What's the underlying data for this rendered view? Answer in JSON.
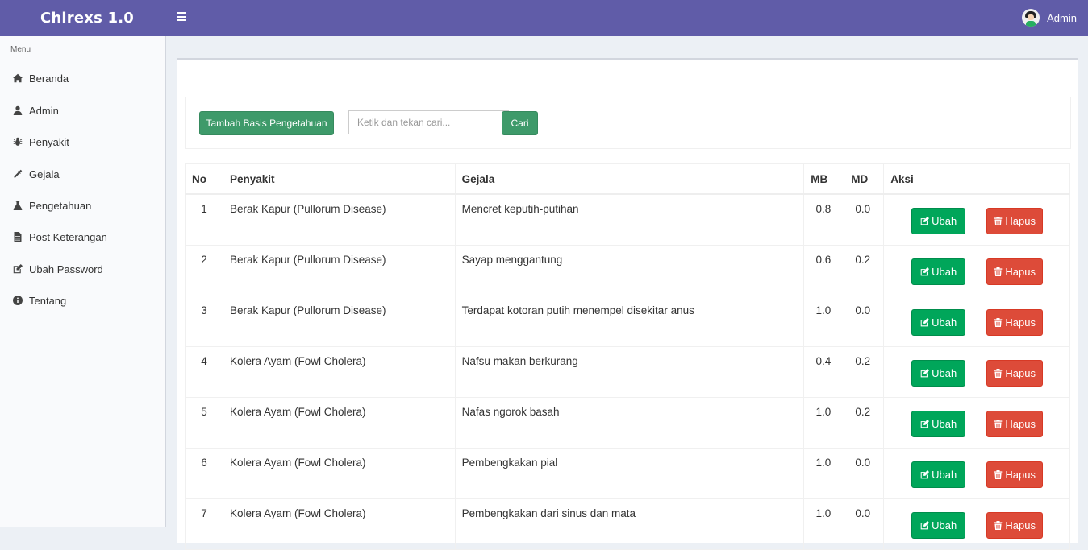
{
  "app": {
    "brand": "Chirexs 1.0",
    "user_name": "Admin"
  },
  "sidebar": {
    "header": "Menu",
    "items": [
      {
        "label": "Beranda",
        "icon": "home-icon"
      },
      {
        "label": "Admin",
        "icon": "user-icon"
      },
      {
        "label": "Penyakit",
        "icon": "bug-icon"
      },
      {
        "label": "Gejala",
        "icon": "eyedropper-icon"
      },
      {
        "label": "Pengetahuan",
        "icon": "flask-icon"
      },
      {
        "label": "Post Keterangan",
        "icon": "file-icon"
      },
      {
        "label": "Ubah Password",
        "icon": "edit-icon"
      },
      {
        "label": "Tentang",
        "icon": "info-icon"
      }
    ]
  },
  "toolbar": {
    "add_label": "Tambah Basis Pengetahuan",
    "search_placeholder": "Ketik dan tekan cari...",
    "search_label": "Cari"
  },
  "table": {
    "headers": [
      "No",
      "Penyakit",
      "Gejala",
      "MB",
      "MD",
      "Aksi"
    ],
    "edit_label": "Ubah",
    "delete_label": "Hapus",
    "rows": [
      {
        "no": "1",
        "penyakit": "Berak Kapur (Pullorum Disease)",
        "gejala": "Mencret keputih-putihan",
        "mb": "0.8",
        "md": "0.0"
      },
      {
        "no": "2",
        "penyakit": "Berak Kapur (Pullorum Disease)",
        "gejala": "Sayap menggantung",
        "mb": "0.6",
        "md": "0.2"
      },
      {
        "no": "3",
        "penyakit": "Berak Kapur (Pullorum Disease)",
        "gejala": "Terdapat kotoran putih menempel disekitar anus",
        "mb": "1.0",
        "md": "0.0"
      },
      {
        "no": "4",
        "penyakit": "Kolera Ayam (Fowl Cholera)",
        "gejala": "Nafsu makan berkurang",
        "mb": "0.4",
        "md": "0.2"
      },
      {
        "no": "5",
        "penyakit": "Kolera Ayam (Fowl Cholera)",
        "gejala": "Nafas ngorok basah",
        "mb": "1.0",
        "md": "0.2"
      },
      {
        "no": "6",
        "penyakit": "Kolera Ayam (Fowl Cholera)",
        "gejala": "Pembengkakan pial",
        "mb": "1.0",
        "md": "0.0"
      },
      {
        "no": "7",
        "penyakit": "Kolera Ayam (Fowl Cholera)",
        "gejala": "Pembengkakan dari sinus dan mata",
        "mb": "1.0",
        "md": "0.0"
      }
    ]
  },
  "colors": {
    "header": "#605ca8",
    "primary_green": "#3e9a6a",
    "success": "#00a65a",
    "danger": "#dd4b39"
  }
}
